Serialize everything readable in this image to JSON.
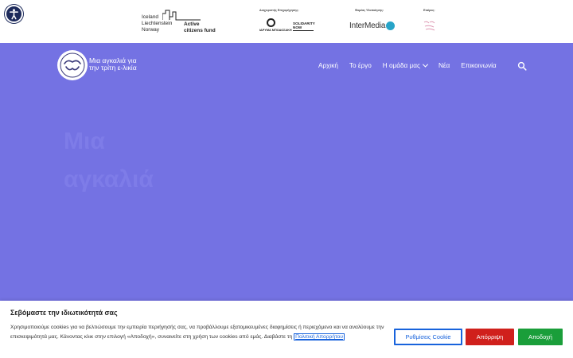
{
  "topbar": {
    "iceland_grant": {
      "countries": [
        "Iceland",
        "Liechtenstein",
        "Norway"
      ],
      "fund_line1": "Active",
      "fund_line2": "citizens fund"
    },
    "label_management": "Διαχειριστής Επιχορήγησης:",
    "label_implementer": "Φορέας Υλοποίησης:",
    "label_partner": "Εταίρος:",
    "bodossaki_text": "ΙΔΡΥΜΑ ΜΠΟΔΟΣΑΚΗ",
    "solidarity_text": "SOLIDARITY NOW",
    "intermedia_text": "InterMedia"
  },
  "header": {
    "site_title": "Μια αγκαλιά για την τρίτη ε-λικία",
    "nav": [
      {
        "label": "Αρχική"
      },
      {
        "label": "Το έργο"
      },
      {
        "label": "Η ομάδα μας",
        "has_dropdown": true
      },
      {
        "label": "Νέα"
      },
      {
        "label": "Επικοινωνία"
      }
    ]
  },
  "hero": {
    "heading_line1": "Μια",
    "heading_line2": "αγκαλιά"
  },
  "cookie": {
    "title": "Σεβόμαστε την ιδιωτικότητά σας",
    "text": "Χρησιμοποιούμε cookies για να βελτιώσουμε την εμπειρία περιήγησής σας, να προβάλλουμε εξατομικευμένες διαφημίσεις ή περιεχόμενο και να αναλύουμε την επισκεψιμότητά μας. Κάνοντας κλικ στην επιλογή «Αποδοχή», συναινείτε στη χρήση των cookies από εμάς. Διαβάστε τη",
    "policy_link": "Πολιτική Απορρήτου",
    "settings_button": "Ρυθμίσεις Cookie",
    "reject_button": "Απόρριψη",
    "accept_button": "Αποδοχή"
  },
  "colors": {
    "hero_bg": "#7472e3",
    "reject": "#d0201c",
    "accept": "#1a9e3a",
    "link": "#1863dc"
  }
}
